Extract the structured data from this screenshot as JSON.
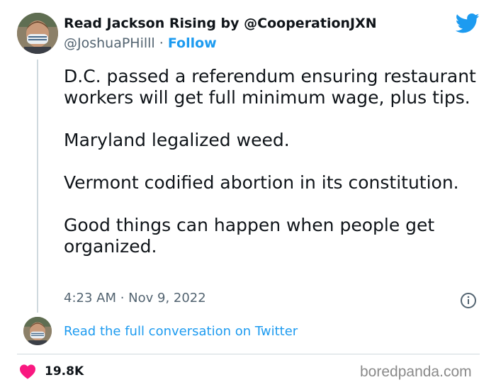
{
  "tweet": {
    "author_name": "Read Jackson Rising by @CooperationJXN",
    "handle": "@JoshuaPHilll",
    "separator": " · ",
    "follow_label": "Follow",
    "paragraphs": [
      "D.C. passed a referendum ensuring restaurant workers will get full minimum wage, plus tips.",
      "Maryland legalized weed.",
      "Vermont codified abortion in its constitution.",
      "Good things can happen when people get organized."
    ],
    "timestamp": "4:23 AM · Nov 9, 2022",
    "conversation_link": "Read the full conversation on Twitter",
    "like_count": "19.8K"
  },
  "watermark": "boredpanda.com",
  "icons": {
    "brand": "twitter-bird-icon",
    "info": "info-icon",
    "like": "heart-icon"
  },
  "colors": {
    "accent": "#1d9bf0",
    "heart": "#f91880",
    "text": "#0f1419",
    "muted": "#536471"
  }
}
